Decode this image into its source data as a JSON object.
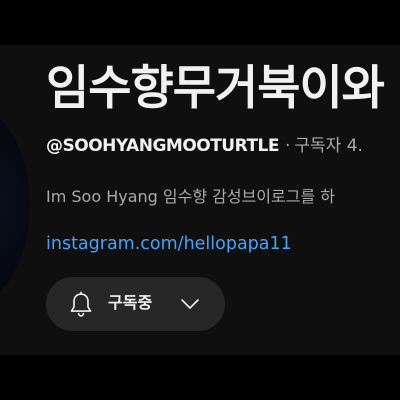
{
  "channel": {
    "name": "임수향무거북이와",
    "handle": "@SOOHYANGMOOTURTLE",
    "separator": "·",
    "subscribers_partial": "구독자 4.",
    "description": "Im Soo Hyang 임수향 감성브이로그를 하",
    "link": "instagram.com/hellopapa11"
  },
  "subscribe": {
    "label": "구독중",
    "bell_icon": "bell-icon",
    "chevron_icon": "chevron-down-icon"
  },
  "colors": {
    "background": "#0f0f0f",
    "outer": "#000000",
    "text_primary": "#f1f1f1",
    "text_secondary": "#aaaaaa",
    "link": "#3ea6ff",
    "button": "#272727"
  }
}
